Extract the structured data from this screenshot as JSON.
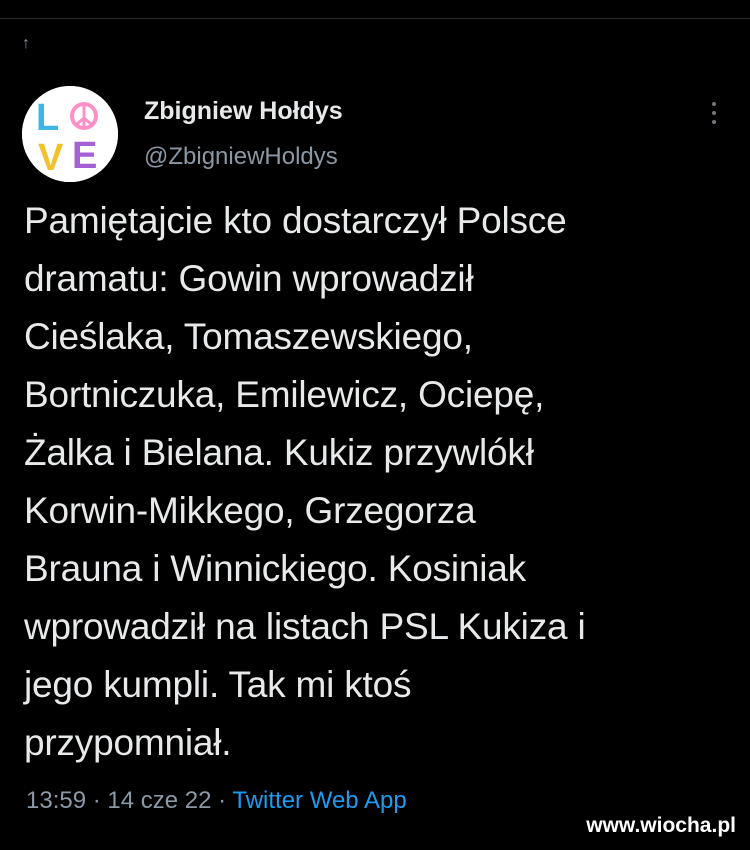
{
  "header": {
    "retweet_icon": "arrow-up-icon",
    "retweet_glyph": "↑"
  },
  "author": {
    "name": "Zbigniew Hołdys",
    "handle": "@ZbigniewHoldys",
    "avatar_letters": [
      "L",
      "O",
      "V",
      "E"
    ],
    "avatar_colors": {
      "L": "#3db5e6",
      "O": "#ff8fc7",
      "V": "#f2c22e",
      "E": "#a660d6"
    }
  },
  "tweet": {
    "text": "Pamiętajcie kto dostarczył Polsce\ndramatu: Gowin wprowadził\nCieślaka, Tomaszewskiego,\nBortniczuka, Emilewicz, Ociepę,\nŻalka i Bielana. Kukiz przywlókł\nKorwin-Mikkego, Grzegorza\nBrauna i Winnickiego. Kosiniak\nwprowadził na listach PSL Kukiza i\njego kumpli. Tak mi ktoś\nprzypomniał."
  },
  "meta": {
    "time": "13:59",
    "sep1": " · ",
    "date": "14 cze 22",
    "sep2": " · ",
    "app": "Twitter Web App"
  },
  "watermark": "www.wiocha.pl",
  "colors": {
    "background": "#000000",
    "text": "#e7e9ea",
    "muted": "#8b98a5",
    "link": "#1d9bf0"
  }
}
